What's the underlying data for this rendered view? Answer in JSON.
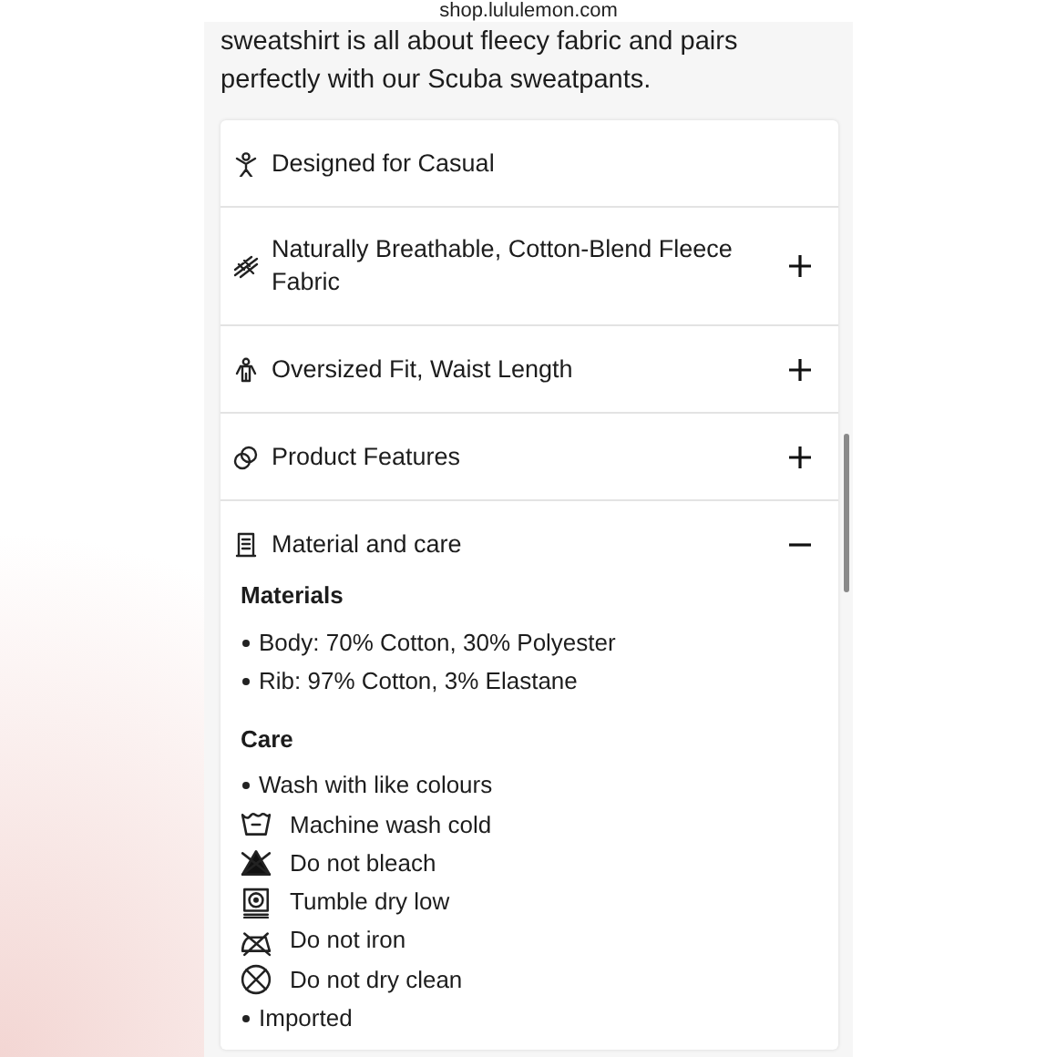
{
  "address_bar": {
    "url": "shop.lululemon.com"
  },
  "description": "sweatshirt is all about fleecy fabric and pairs perfectly with our Scuba sweatpants.",
  "sections": [
    {
      "title": "Designed for Casual"
    },
    {
      "title": "Naturally Breathable, Cotton-Blend Fleece Fabric",
      "expanded": false
    },
    {
      "title": "Oversized Fit, Waist Length",
      "expanded": false
    },
    {
      "title": "Product Features",
      "expanded": false
    },
    {
      "title": "Material and care",
      "expanded": true,
      "details": [
        {
          "heading": "Materials",
          "items": [
            {
              "kind": "bullet",
              "text": "Body: 70% Cotton, 30% Polyester"
            },
            {
              "kind": "bullet",
              "text": "Rib: 97% Cotton, 3% Elastane"
            }
          ]
        },
        {
          "heading": "Care",
          "items": [
            {
              "kind": "bullet",
              "text": "Wash with like colours"
            },
            {
              "kind": "wash",
              "text": "Machine wash cold"
            },
            {
              "kind": "bleach",
              "text": "Do not bleach"
            },
            {
              "kind": "dry",
              "text": "Tumble dry low"
            },
            {
              "kind": "iron",
              "text": "Do not iron"
            },
            {
              "kind": "dryclean",
              "text": "Do not dry clean"
            },
            {
              "kind": "bullet",
              "text": "Imported"
            }
          ]
        }
      ]
    }
  ]
}
